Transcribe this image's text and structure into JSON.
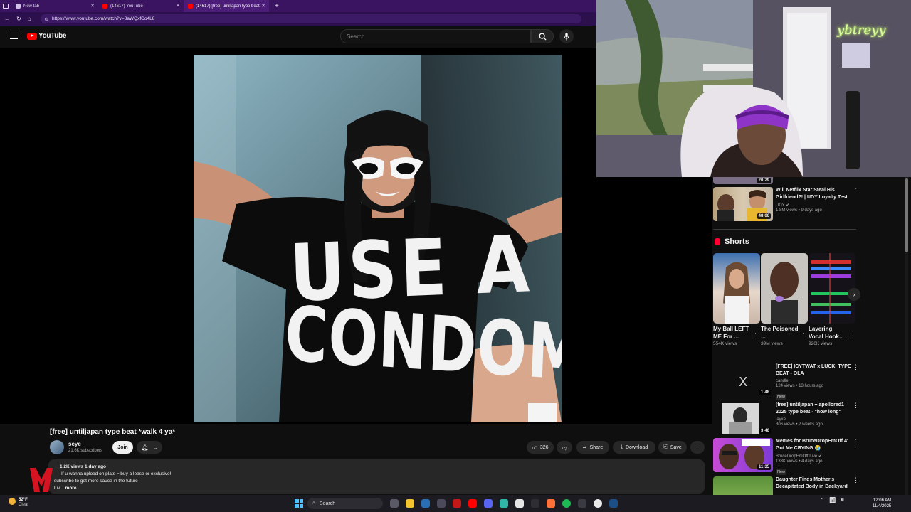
{
  "browser": {
    "tabs": [
      {
        "label": "New tab",
        "favicon": "new-tab-icon",
        "active": false
      },
      {
        "label": "(14617) YouTube",
        "favicon": "youtube-icon",
        "active": false
      },
      {
        "label": "(14617) [free] untiljapan type beat",
        "favicon": "youtube-icon",
        "active": true
      }
    ],
    "new_tab_symbol": "+",
    "url": "https://www.youtube.com/watch?v=8aWQxfCo4L8"
  },
  "header": {
    "logo_text": "YouTube",
    "search_placeholder": "Search"
  },
  "video": {
    "title": "[free] untiljapan type beat *walk 4 ya*",
    "artwork_text_line1": "USE A",
    "artwork_text_line2": "CONDOM"
  },
  "channel": {
    "name": "seye",
    "subscribers": "21.6K subscribers",
    "join_label": "Join"
  },
  "actions": {
    "like_count": "326",
    "share_label": "Share",
    "download_label": "Download",
    "save_label": "Save"
  },
  "description": {
    "meta": "1.2K views  1 day ago",
    "line1": "If u wanna upload on plats = buy a lease or exclusive!",
    "line2": "subscribe to get more sauce in the future",
    "line3_prefix": "luv",
    "more_label": "...more"
  },
  "stream_overlay": {
    "streamer_name": "ybtreyy"
  },
  "sidebar": {
    "partial_top_duration": "20:29",
    "videos_top": [
      {
        "title": "Will Netflix Star Steal His Girlfriend?! | UDY Loyalty Test",
        "channel": "UDY",
        "verified": true,
        "views": "1.8M views • 9 days ago",
        "duration": "48:06"
      }
    ],
    "shorts_heading": "Shorts",
    "shorts": [
      {
        "title": "My Ball LEFT ME For ...",
        "views": "554K views"
      },
      {
        "title": "The Poisoned ...",
        "views": "39M views"
      },
      {
        "title": "Layering Vocal Hook...",
        "views": "926K views"
      }
    ],
    "videos": [
      {
        "title": "[FREE] ICYTWAT x LUCKI TYPE BEAT - OLA",
        "channel": "candle",
        "views": "124 views • 13 hours ago",
        "badge": "New",
        "duration": "1:48"
      },
      {
        "title": "[free] untiljapan + apollored1 2025 type beat - \"how long\"",
        "channel": "jayxe",
        "views": "306 views • 2 weeks ago",
        "badge": "",
        "duration": "3:40"
      },
      {
        "title": "Memes for BruceDropEmOff 4' Got Me CRYING 😭",
        "channel": "BruceDropEmOff Live",
        "views": "133K views • 4 days ago",
        "badge": "New",
        "duration": "11:35"
      },
      {
        "title": "Daughter Finds Mother's Decapitated Body in Backyard",
        "channel": "",
        "views": "",
        "badge": "",
        "duration": ""
      }
    ]
  },
  "taskbar": {
    "weather_temp": "52°F",
    "weather_desc": "Clear",
    "search_label": "Search",
    "time": "12:06 AM",
    "date": "11/4/2025"
  },
  "colors": {
    "browser_frame": "#3a1460",
    "youtube_red": "#ff0000",
    "background": "#0f0f0f",
    "neon_text": "#d8ff9a"
  }
}
